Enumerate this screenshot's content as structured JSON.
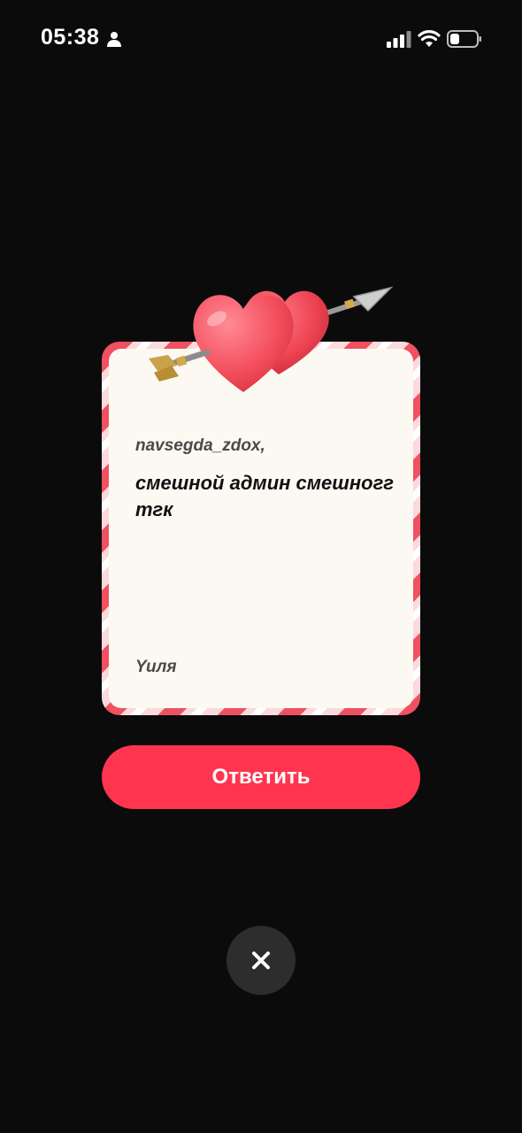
{
  "status_bar": {
    "time": "05:38",
    "icons": [
      "person-icon",
      "signal-icon",
      "wifi-icon",
      "battery-icon"
    ]
  },
  "card": {
    "decoration": "hearts-with-arrow",
    "recipient": "navsegda_zdox,",
    "message": "смешной админ смешногг тгк",
    "signature": "Yuля"
  },
  "actions": {
    "reply_label": "Ответить",
    "close_icon": "close-icon"
  },
  "colors": {
    "background": "#0b0b0b",
    "accent": "#ff3550",
    "card_paper": "#fbf9f2",
    "card_border_stripe": "#ee5160",
    "close_button": "#2d2d2d"
  }
}
